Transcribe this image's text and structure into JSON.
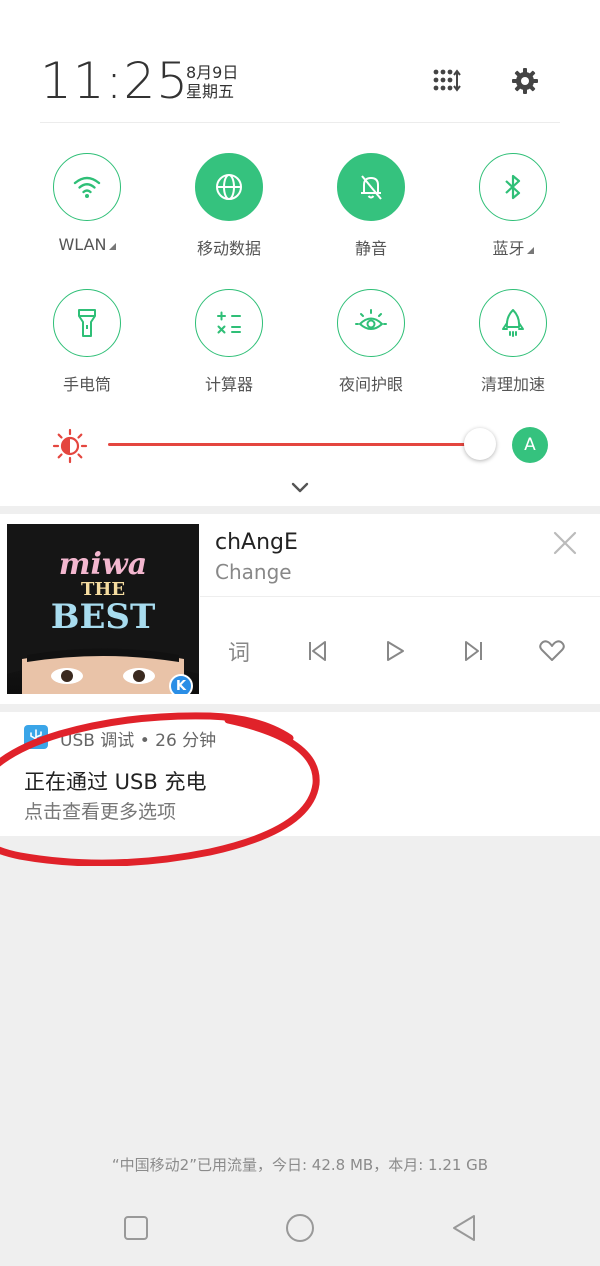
{
  "status": {
    "time": "11:25",
    "date_line1": "8月9日",
    "date_line2": "星期五"
  },
  "header_icons": [
    "edit-tiles-icon",
    "gear-icon"
  ],
  "tiles": [
    {
      "label": "WLAN",
      "icon": "wifi-icon",
      "active": false,
      "has_menu": true
    },
    {
      "label": "移动数据",
      "icon": "globe-icon",
      "active": true,
      "has_menu": false
    },
    {
      "label": "静音",
      "icon": "bell-off-icon",
      "active": true,
      "has_menu": false
    },
    {
      "label": "蓝牙",
      "icon": "bluetooth-icon",
      "active": false,
      "has_menu": true
    },
    {
      "label": "手电筒",
      "icon": "flashlight-icon",
      "active": false,
      "has_menu": false
    },
    {
      "label": "计算器",
      "icon": "calculator-icon",
      "active": false,
      "has_menu": false
    },
    {
      "label": "夜间护眼",
      "icon": "eye-care-icon",
      "active": false,
      "has_menu": false
    },
    {
      "label": "清理加速",
      "icon": "rocket-icon",
      "active": false,
      "has_menu": false
    }
  ],
  "brightness": {
    "level": 0.97,
    "auto_label": "A"
  },
  "music": {
    "title": "chAngE",
    "artist": "Change",
    "album_text_line1": "miwa",
    "album_text_line2": "THE",
    "album_text_line3": "BEST",
    "app_badge": "K",
    "lyrics_label": "词"
  },
  "notification": {
    "app_line": "USB 调试 • 26 分钟",
    "title": "正在通过 USB 充电",
    "subtitle": "点击查看更多选项"
  },
  "data_usage": "“中国移动2”已用流量，今日: 42.8 MB，本月: 1.21 GB",
  "colors": {
    "accent_green": "#35c27e",
    "brightness_red": "#e4463f",
    "usb_blue": "#3aa5e8",
    "annotation_red": "#e0222a"
  }
}
